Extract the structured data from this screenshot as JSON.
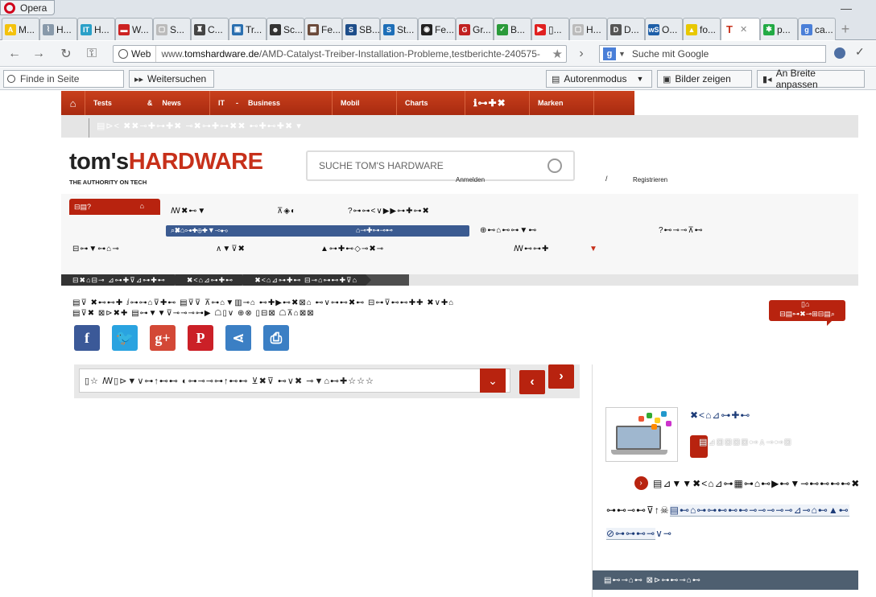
{
  "browser": {
    "app_label": "Opera",
    "minimize_glyph": "—",
    "tabs": [
      {
        "label": "M...",
        "icon": "adac-icon",
        "color": "#f4c20d",
        "text": "A"
      },
      {
        "label": "H...",
        "icon": "paperclip-icon",
        "color": "#8899aa",
        "text": "⌇"
      },
      {
        "label": "H...",
        "icon": "it-icon",
        "color": "#2aa0c8",
        "text": "IT"
      },
      {
        "label": "W...",
        "icon": "car-icon",
        "color": "#cc2222",
        "text": "▬"
      },
      {
        "label": "S...",
        "icon": "page-icon",
        "color": "#bbbbbb",
        "text": "▢"
      },
      {
        "label": "C...",
        "icon": "trophy-icon",
        "color": "#444444",
        "text": "♜"
      },
      {
        "label": "Tr...",
        "icon": "bus-icon",
        "color": "#2a6fb0",
        "text": "▣"
      },
      {
        "label": "Sc...",
        "icon": "person-icon",
        "color": "#333333",
        "text": "☻"
      },
      {
        "label": "Fe...",
        "icon": "photo-icon",
        "color": "#6b4a3a",
        "text": "▦"
      },
      {
        "label": "SB...",
        "icon": "sb-icon",
        "color": "#1e4e8a",
        "text": "S"
      },
      {
        "label": "St...",
        "icon": "st-icon",
        "color": "#1e6fb8",
        "text": "S"
      },
      {
        "label": "Fe...",
        "icon": "medal-icon",
        "color": "#222222",
        "text": "◉"
      },
      {
        "label": "Gr...",
        "icon": "gr-icon",
        "color": "#c02020",
        "text": "G"
      },
      {
        "label": "B...",
        "icon": "shield-icon",
        "color": "#2a9a3a",
        "text": "✓"
      },
      {
        "label": "▯...",
        "icon": "youtube-icon",
        "color": "#e02020",
        "text": "▶"
      },
      {
        "label": "H...",
        "icon": "page-icon",
        "color": "#bbbbbb",
        "text": "▢"
      },
      {
        "label": "D...",
        "icon": "dgf-icon",
        "color": "#555555",
        "text": "D"
      },
      {
        "label": "O...",
        "icon": "ws-icon",
        "color": "#1e5fa8",
        "text": "wS"
      },
      {
        "label": "fo...",
        "icon": "warning-icon",
        "color": "#e8c800",
        "text": "▲"
      },
      {
        "label": "",
        "icon": "toms-t-icon",
        "color": "#ffffff",
        "text": "T",
        "active": true
      },
      {
        "label": "p...",
        "icon": "star-green-icon",
        "color": "#22aa44",
        "text": "✱"
      },
      {
        "label": "ca...",
        "icon": "google-icon",
        "color": "#4a7fd8",
        "text": "g"
      }
    ],
    "tab_close_glyph": "✕",
    "new_tab_glyph": "+",
    "web_chip": "Web",
    "url_prefix": "www.",
    "url_domain": "tomshardware.de",
    "url_path": "/AMD-Catalyst-Treiber-Installation-Probleme,testberichte-240575-",
    "search_engine_badge": "g",
    "search_placeholder": "Suche mit Google",
    "find_placeholder": "Finde in Seite",
    "find_next": "Weitersuchen",
    "author_mode": "Autorenmodus",
    "show_images": "Bilder zeigen",
    "fit_width": "An Breite anpassen"
  },
  "site": {
    "topnav": [
      "Tests",
      "&",
      "News",
      "IT",
      "-",
      "Business",
      "Mobil",
      "Charts",
      "ℹ⊶✚✖",
      "Marken"
    ],
    "home_glyph": "⌂",
    "subnav_glyphs": "▤⊳< ✖✖⊸✚⊶✚✖ ⊸✖⊶✚⊶✖✖ ⊷✚⊷✚✖ ▾",
    "logo_part1": "tom's",
    "logo_part2": "HARDWARE",
    "tagline": "THE AUTHORITY ON TECH",
    "search_placeholder": "SUCHE TOM'S HARDWARE",
    "login": "Anmelden",
    "slash": "/",
    "register": "Registrieren",
    "cat_red": "⊟▤?",
    "cat_red_icon": "⌂",
    "cats": [
      "ꟿ✖⊷▼",
      "⊼◈◐",
      "?⊶⊶<∨▶▶⊶✚⊶✖",
      "⊕⊷⌂⊷⊶▼⊷",
      "?⊷⊸⊸⊼⊷",
      "⊟⊶▼⊶⌂⊸",
      "∧▼⊽✖",
      "▲⊶✚⊷◇⊸✖⊸",
      "ꟿ⊷⊶✚"
    ],
    "cat_blue_left": "⌕✖⌂⊶✚⊕✚▼⊸⊷",
    "cat_blue_right": "⌂⊸✚⊶⊸⊷",
    "cat_arrow": "▼",
    "breadcrumbs": [
      "⊟✖⌂⊟⊸ ⊿⊶✚⊽⊿⊶✚⊷",
      "✖<⌂⊿⊶✚⊷",
      "✖<⌂⊿⊶✚⊷ ⊟⊸⌂⊶⊷✚⊽⌂"
    ],
    "meta_line1": "▤⊽ ✖⊷⊷✚ ⅈ⊶⊶⌂⊽✚⊷ ▤⊽⊽ ⊼⊶⌂▼▥⊸⌂ ⊷✚▶⊷✖⊠⌂ ⊷∨⊶⊷✖⊷ ⊟⊶⊽⊷⊷✚✚ ✖∨✚⌂",
    "meta_line2": "▤⊽✖ ⊠⊳✖✚ ▤⊶▼▼⊽⊸⊸⊸⊶▶ ☖▯∨ ⊕⊗ ▯⊟⊠ ☖⊼⌂⊠⊠",
    "comment_count": "▯⌂",
    "comment_label": "⊟▤⊶✖⊸⊞⊟▤⌕",
    "share_buttons": [
      {
        "name": "facebook-share-button",
        "glyph": "f",
        "color": "#3b5998"
      },
      {
        "name": "twitter-share-button",
        "glyph": "🐦",
        "color": "#2aa3e0"
      },
      {
        "name": "googleplus-share-button",
        "glyph": "g+",
        "color": "#d34836"
      },
      {
        "name": "pinterest-share-button",
        "glyph": "P",
        "color": "#cb2027"
      },
      {
        "name": "share-button",
        "glyph": "⋖",
        "color": "#3b7fc4"
      },
      {
        "name": "print-button",
        "glyph": "⎙",
        "color": "#3b7fc4"
      }
    ],
    "pager_label": "▯☆ ꟿ▯⊳▼∨⊶↑⊷⊷ ◐⊶⊸⊸⊶↑⊷⊷ ⊻✖⊽ ⊷∨✖ ⊸▼⌂⊷✚☆☆☆",
    "pager_toggle": "⌄",
    "pager_prev": "‹",
    "pager_next": "›",
    "promo_title": "✖<⌂⊿⊶✚⊷",
    "promo_btn_label": "▤⊿⊠⊠⊠⊠⊷∧⊸⊷⊠",
    "link_chevron": "›",
    "link_text": "▤⊿▼▼✖<⌂⊿⊶▦⊶⌂⊷▶⊷▼⊸⊷⊷⊷⊷✖",
    "tags_row1_plain": "⊶⊷⊸⊷⊽↑☠",
    "tags_row1_link": "▤⊷⌂⊶⊶⊷⊷⊷⊸⊸⊸⊸⊸⊿⊸⌂⊷▲⊷",
    "tags_row2_link": "⊘⊶⊶⊷⊸",
    "tags_row2_plain": "∨⊸",
    "sidebar_header": "▤⊷⊸⌂⊷ ⊠⊳⊶⊷⊸⌂⊷"
  },
  "colors": {
    "brand_red": "#c7301a",
    "nav_blue": "#3b5b91",
    "sidebar_header": "#4e5f70"
  }
}
